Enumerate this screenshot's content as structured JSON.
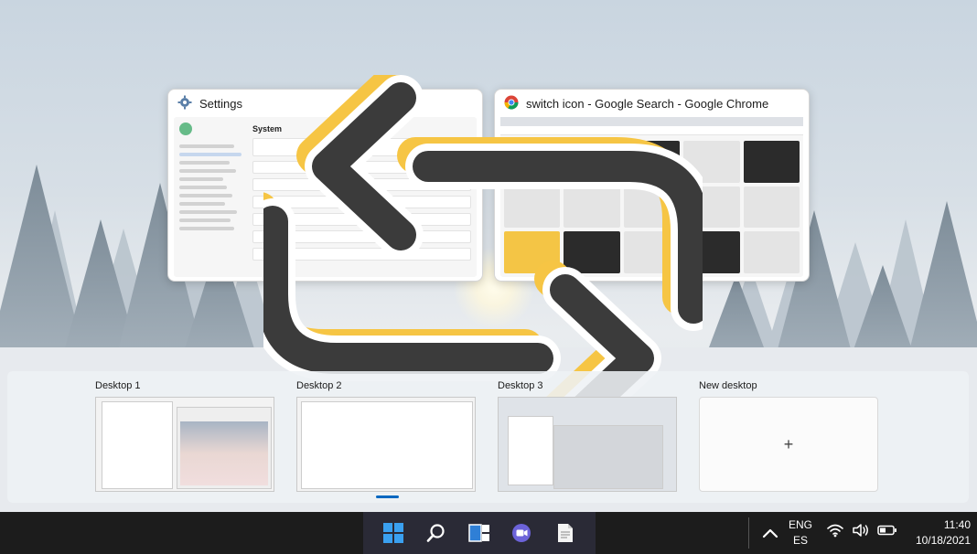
{
  "windows": [
    {
      "title": "Settings",
      "icon": "gear-icon"
    },
    {
      "title": "switch icon - Google Search - Google Chrome",
      "icon": "chrome-icon"
    }
  ],
  "settings_mock": {
    "section_title": "System"
  },
  "desktops": {
    "items": [
      {
        "label": "Desktop 1"
      },
      {
        "label": "Desktop 2"
      },
      {
        "label": "Desktop 3"
      }
    ],
    "new_desktop_label": "New desktop",
    "new_desktop_symbol": "+"
  },
  "taskbar": {
    "pinned": [
      {
        "name": "start-button",
        "icon": "windows-logo-icon"
      },
      {
        "name": "search-button",
        "icon": "search-icon"
      },
      {
        "name": "task-view-button",
        "icon": "task-view-icon"
      },
      {
        "name": "chat-button",
        "icon": "video-chat-icon"
      },
      {
        "name": "notepad-button",
        "icon": "document-icon"
      }
    ],
    "accent": "#0078d4",
    "language_line1": "ENG",
    "language_line2": "ES",
    "time": "11:40",
    "date": "10/18/2021"
  },
  "colors": {
    "switch_yellow": "#f6c544",
    "switch_dark": "#3b3b3b",
    "taskbar_bg": "#1c1c1c"
  }
}
